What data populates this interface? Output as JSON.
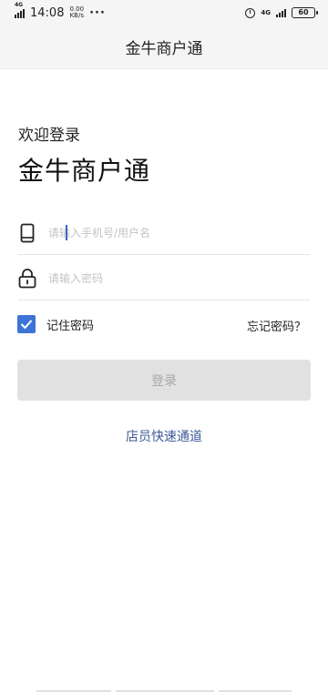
{
  "status_bar": {
    "network_type": "4G",
    "time": "14:08",
    "speed_value": "0.00",
    "speed_unit": "KB/s",
    "more_glyph": "···",
    "network_type_right": "4G",
    "battery_level": "60"
  },
  "header": {
    "title": "金牛商户通"
  },
  "login": {
    "welcome": "欢迎登录",
    "brand": "金牛商户通",
    "phone_placeholder": "请输入手机号/用户名",
    "password_placeholder": "请输入密码",
    "remember_label": "记住密码",
    "remember_checked": true,
    "forgot_label": "忘记密码？",
    "submit_label": "登录",
    "staff_link": "店员快速通道"
  },
  "colors": {
    "accent": "#3d74d6",
    "link": "#3c5a9a",
    "button_disabled_bg": "#e1e1e1",
    "button_disabled_text": "#a8a8a8",
    "header_bg": "#f5f5f5"
  },
  "icons": {
    "phone_field": "mobile-phone-icon",
    "password_field": "padlock-icon",
    "remember": "checkmark-icon"
  }
}
